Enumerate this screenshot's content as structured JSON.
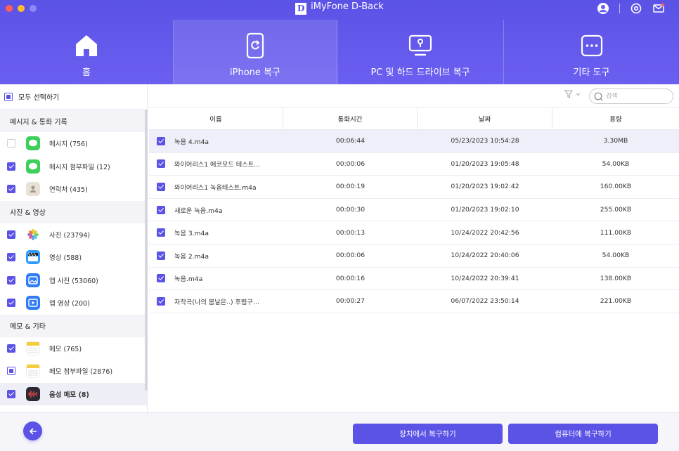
{
  "app": {
    "title": "iMyFone D-Back",
    "logo_letter": "D"
  },
  "colors": {
    "accent": "#5b52e6",
    "header": "#6a5ff0"
  },
  "header_icons": [
    "account-icon",
    "settings-icon",
    "mail-icon"
  ],
  "tabs": [
    {
      "label": "홈",
      "icon": "home-icon",
      "active": false
    },
    {
      "label": "iPhone 복구",
      "icon": "phone-recover-icon",
      "active": true
    },
    {
      "label": "PC 및 하드 드라이브 복구",
      "icon": "pc-drive-icon",
      "active": false
    },
    {
      "label": "기타 도구",
      "icon": "more-icon",
      "active": false
    }
  ],
  "sidebar": {
    "select_all": "모두 선택하기",
    "categories": [
      {
        "title": "메시지 & 통화 기록",
        "items": [
          {
            "label": "메시지 (756)",
            "state": "empty",
            "icon": "messages-icon"
          },
          {
            "label": "메시지 첨부파일 (12)",
            "state": "checked",
            "icon": "messages-icon"
          },
          {
            "label": "연락처 (435)",
            "state": "checked",
            "icon": "contacts-icon"
          }
        ]
      },
      {
        "title": "사진 & 영상",
        "items": [
          {
            "label": "사진 (23794)",
            "state": "checked",
            "icon": "photos-icon"
          },
          {
            "label": "영상 (588)",
            "state": "checked",
            "icon": "video-icon"
          },
          {
            "label": "앱 사진 (53060)",
            "state": "checked",
            "icon": "app-photo-icon"
          },
          {
            "label": "앱 영상 (200)",
            "state": "checked",
            "icon": "app-video-icon"
          }
        ]
      },
      {
        "title": "메모 & 기타",
        "items": [
          {
            "label": "메모 (765)",
            "state": "checked",
            "icon": "notes-icon"
          },
          {
            "label": "메모 첨부파일 (2876)",
            "state": "partial",
            "icon": "notes-icon"
          },
          {
            "label": "음성 메모 (8)",
            "state": "checked",
            "icon": "voice-memo-icon"
          }
        ]
      }
    ]
  },
  "search": {
    "placeholder": "검색"
  },
  "table": {
    "headers": [
      "이름",
      "통화시간",
      "날짜",
      "용량"
    ],
    "rows": [
      {
        "name": "녹음 4.m4a",
        "duration": "00:06:44",
        "date": "05/23/2023 10:54:28",
        "size": "3.30MB"
      },
      {
        "name": "와이어리스1 에코모드 테스트…",
        "duration": "00:00:06",
        "date": "01/20/2023 19:05:48",
        "size": "54.00KB"
      },
      {
        "name": "와이어리스1 녹음테스트.m4a",
        "duration": "00:00:19",
        "date": "01/20/2023 19:02:42",
        "size": "160.00KB"
      },
      {
        "name": "새로운 녹음.m4a",
        "duration": "00:00:30",
        "date": "01/20/2023 19:02:10",
        "size": "255.00KB"
      },
      {
        "name": "녹음 3.m4a",
        "duration": "00:00:13",
        "date": "10/24/2022 20:42:56",
        "size": "111.00KB"
      },
      {
        "name": "녹음 2.m4a",
        "duration": "00:00:06",
        "date": "10/24/2022 20:40:06",
        "size": "54.00KB"
      },
      {
        "name": "녹음.m4a",
        "duration": "00:00:16",
        "date": "10/24/2022 20:39:41",
        "size": "138.00KB"
      },
      {
        "name": "자작곡(나의 봄날은..) 후렴구…",
        "duration": "00:00:27",
        "date": "06/07/2022 23:50:14",
        "size": "221.00KB"
      }
    ]
  },
  "footer": {
    "recover_device": "장치에서 복구하기",
    "recover_pc": "컴퓨터에 복구하기"
  }
}
